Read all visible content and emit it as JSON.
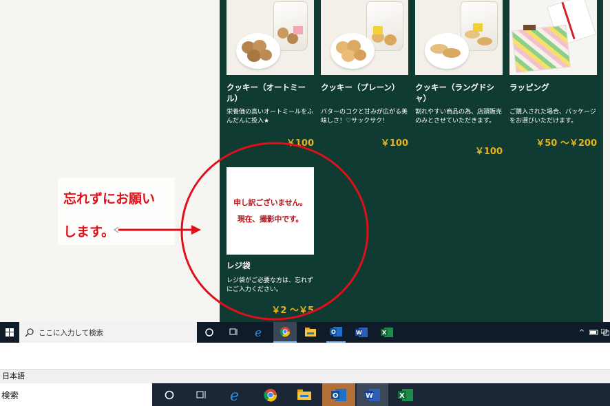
{
  "products": [
    {
      "title": "クッキー（オートミール）",
      "desc": "栄養価の高いオートミールをふんだんに投入★",
      "price": "￥100"
    },
    {
      "title": "クッキー（プレーン）",
      "desc": "バターのコクと甘みが広がる美味しさ！♡サックサク！",
      "price": "￥100"
    },
    {
      "title": "クッキー（ラングドシャ）",
      "desc": "割れやすい商品の為、店頭販売のみとさせていただきます。",
      "price": "￥100"
    },
    {
      "title": "ラッピング",
      "desc": "ご購入された場合、パッケージをお選びいただけます。",
      "price": "￥50 〜￥200"
    },
    {
      "title": "レジ袋",
      "desc": "レジ袋がご必要な方は、忘れずにご入力ください。",
      "price": "￥2 〜￥5"
    }
  ],
  "nophoto": {
    "line1": "申し訳ございません。",
    "line2": "現在、撮影中です。"
  },
  "note": {
    "line1": "忘れずにお願い",
    "line2": "します。"
  },
  "taskbar": {
    "search_placeholder": "ここに入力して検索"
  },
  "langbar": {
    "label": "日本語"
  },
  "taskbar2": {
    "search_label": "検索"
  },
  "colors": {
    "panel": "#0f3b33",
    "price": "#e9b31b",
    "annotation": "#e0101a"
  }
}
